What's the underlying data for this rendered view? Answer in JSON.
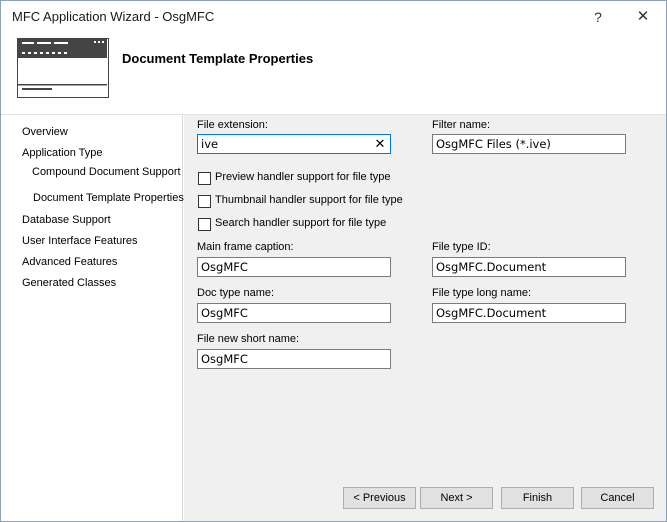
{
  "window": {
    "title": "MFC Application Wizard - OsgMFC",
    "help_glyph": "?",
    "close_glyph": "✕"
  },
  "header": {
    "title": "Document Template Properties"
  },
  "nav": {
    "items": [
      {
        "label": "Overview"
      },
      {
        "label": "Application Type"
      },
      {
        "label": "Compound Document Support"
      },
      {
        "label": "Document Template Properties"
      },
      {
        "label": "Database Support"
      },
      {
        "label": "User Interface Features"
      },
      {
        "label": "Advanced Features"
      },
      {
        "label": "Generated Classes"
      }
    ]
  },
  "form": {
    "file_extension": {
      "label": "File extension:",
      "value": "ive",
      "clear_glyph": "✕"
    },
    "filter_name": {
      "label": "Filter name:",
      "value": "OsgMFC Files (*.ive)"
    },
    "checkboxes": [
      {
        "label": "Preview handler support for file type",
        "checked": false
      },
      {
        "label": "Thumbnail handler support for file type",
        "checked": false
      },
      {
        "label": "Search handler support for file type",
        "checked": false
      }
    ],
    "main_frame_caption": {
      "label": "Main frame caption:",
      "value": "OsgMFC"
    },
    "file_type_id": {
      "label": "File type ID:",
      "value": "OsgMFC.Document"
    },
    "doc_type_name": {
      "label": "Doc type name:",
      "value": "OsgMFC"
    },
    "file_type_long_name": {
      "label": "File type long name:",
      "value": "OsgMFC.Document"
    },
    "file_new_short_name": {
      "label": "File new short name:",
      "value": "OsgMFC"
    }
  },
  "buttons": {
    "previous": "< Previous",
    "next": "Next >",
    "finish": "Finish",
    "cancel": "Cancel"
  },
  "colors": {
    "content_bg": "#f0f0f0",
    "focus_border": "#0078d7",
    "button_bg": "#e1e1e1"
  }
}
